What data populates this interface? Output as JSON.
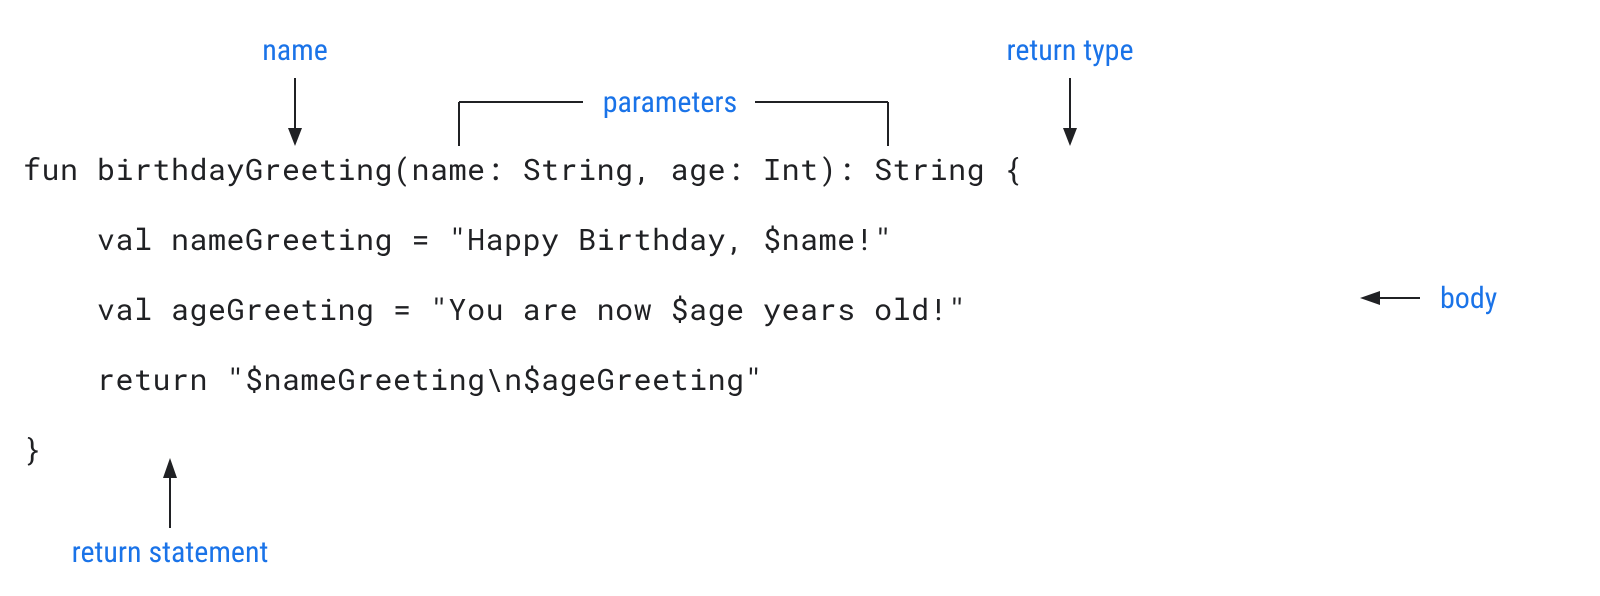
{
  "labels": {
    "name": "name",
    "parameters": "parameters",
    "return_type": "return type",
    "body": "body",
    "return_statement": "return statement"
  },
  "code": {
    "line1": "fun birthdayGreeting(name: String, age: Int): String {",
    "line2": "    val nameGreeting = \"Happy Birthday, $name!\"",
    "line3": "    val ageGreeting = \"You are now $age years old!\"",
    "line4": "    return \"$nameGreeting\\n$ageGreeting\"",
    "line5": "}"
  },
  "colors": {
    "label": "#1a73e8",
    "code": "#202124",
    "arrow": "#202124"
  }
}
